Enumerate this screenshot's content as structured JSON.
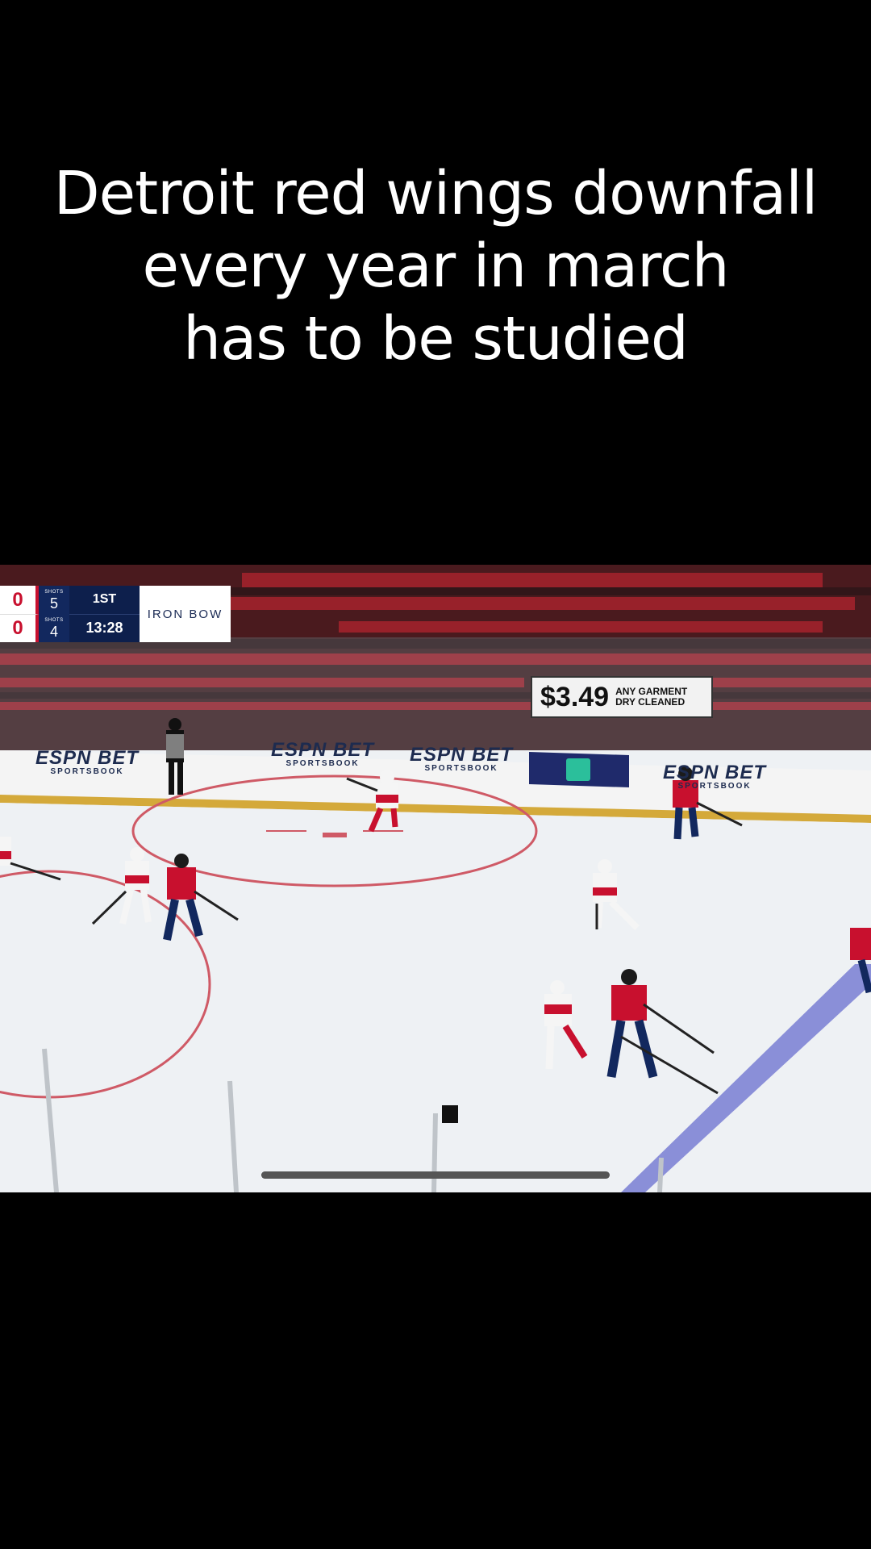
{
  "caption": {
    "lines": [
      "Detroit red wings downfall",
      "every year in march",
      "has to be studied"
    ]
  },
  "scorebug": {
    "home_score": "0",
    "away_score": "0",
    "shots_label": "SHOTS",
    "home_shots": "5",
    "away_shots": "4",
    "period": "1ST",
    "clock": "13:28",
    "sponsor": "IRON BOW"
  },
  "arena_ads": {
    "price": "$3.49",
    "price_line1": "ANY GARMENT",
    "price_line2": "DRY CLEANED",
    "board_brand": "ESPN BET",
    "board_sub": "SPORTSBOOK"
  },
  "colors": {
    "wings_red": "#c8102e",
    "caps_navy": "#12285e",
    "ice": "#eef1f4",
    "blue_line": "#8a8fd8"
  },
  "player": {
    "progress": 0.5
  }
}
